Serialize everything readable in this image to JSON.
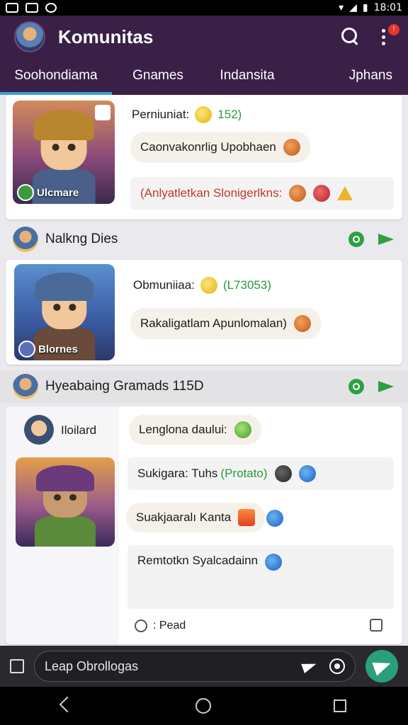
{
  "status_bar": {
    "time": "18:01"
  },
  "app_bar": {
    "title": "Komunitas",
    "notification_badge": "!"
  },
  "tabs": [
    {
      "label": "Soohondiama",
      "active": true
    },
    {
      "label": "Gnames",
      "active": false
    },
    {
      "label": "Indansita",
      "active": false
    },
    {
      "label": "Jphans",
      "active": false
    }
  ],
  "card1": {
    "thumb_label": "Ulcmare",
    "line1_label": "Perniuniat:",
    "line1_value": "152)",
    "bubble1": "Caonvakonrlig Upobhaen",
    "bubble2": "(Anlyatletkan Slonigerlkns:"
  },
  "section1": {
    "title": "Nalkng Dies"
  },
  "card2": {
    "thumb_label": "Blornes",
    "line1_label": "Obmuniiaa:",
    "line1_value": "(L73053)",
    "bubble1": "Rakaligatlam Apunlomalan)"
  },
  "section2": {
    "title": "Hyeabaing Gramads 115D"
  },
  "card3": {
    "user_name": "Iloilard",
    "msg1": "Lenglona daului:",
    "msg2_text": "Sukigara: Tuhs",
    "msg2_highlight": "(Protato)",
    "msg3": "Suakjaaralı Kanta",
    "msg4": "Remtotkn Syalcadainn",
    "footer_text": ": Pead"
  },
  "input": {
    "value": "Leap Obrollogas"
  }
}
